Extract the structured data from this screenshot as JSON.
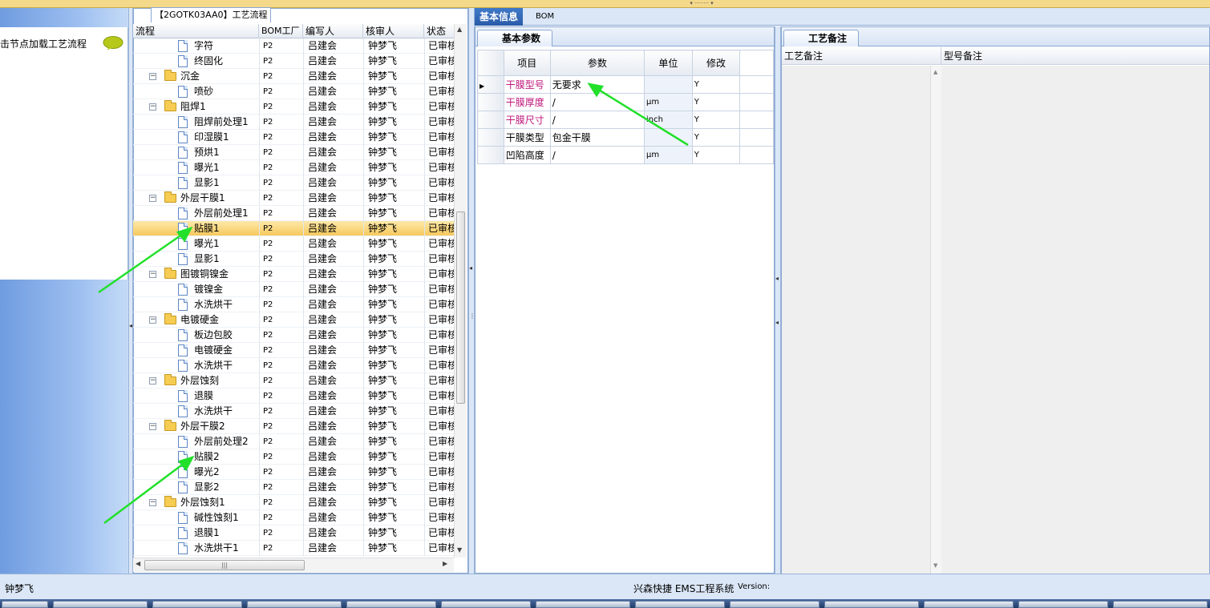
{
  "left_panel": {
    "hint": "击节点加载工艺流程",
    "chat_icon": "speech-bubble-icon"
  },
  "tree": {
    "title": "【2GOTK03AA0】工艺流程",
    "columns": {
      "flow": "流程",
      "bom": "BOM工厂",
      "author": "编写人",
      "reviewer": "核审人",
      "status": "状态"
    },
    "rows": [
      {
        "label": "字符",
        "type": "doc",
        "level": 2,
        "bom": "P2",
        "author": "吕建会",
        "reviewer": "钟梦飞",
        "status": "已审核",
        "selected": false
      },
      {
        "label": "终固化",
        "type": "doc",
        "level": 2,
        "bom": "P2",
        "author": "吕建会",
        "reviewer": "钟梦飞",
        "status": "已审核",
        "selected": false
      },
      {
        "label": "沉金",
        "type": "folder",
        "level": 1,
        "bom": "P2",
        "author": "吕建会",
        "reviewer": "钟梦飞",
        "status": "已审核",
        "selected": false
      },
      {
        "label": "喷砂",
        "type": "doc",
        "level": 2,
        "bom": "P2",
        "author": "吕建会",
        "reviewer": "钟梦飞",
        "status": "已审核",
        "selected": false
      },
      {
        "label": "阻焊1",
        "type": "folder",
        "level": 1,
        "bom": "P2",
        "author": "吕建会",
        "reviewer": "钟梦飞",
        "status": "已审核",
        "selected": false
      },
      {
        "label": "阻焊前处理1",
        "type": "doc",
        "level": 2,
        "bom": "P2",
        "author": "吕建会",
        "reviewer": "钟梦飞",
        "status": "已审核",
        "selected": false
      },
      {
        "label": "印湿膜1",
        "type": "doc",
        "level": 2,
        "bom": "P2",
        "author": "吕建会",
        "reviewer": "钟梦飞",
        "status": "已审核",
        "selected": false
      },
      {
        "label": "预烘1",
        "type": "doc",
        "level": 2,
        "bom": "P2",
        "author": "吕建会",
        "reviewer": "钟梦飞",
        "status": "已审核",
        "selected": false
      },
      {
        "label": "曝光1",
        "type": "doc",
        "level": 2,
        "bom": "P2",
        "author": "吕建会",
        "reviewer": "钟梦飞",
        "status": "已审核",
        "selected": false
      },
      {
        "label": "显影1",
        "type": "doc",
        "level": 2,
        "bom": "P2",
        "author": "吕建会",
        "reviewer": "钟梦飞",
        "status": "已审核",
        "selected": false
      },
      {
        "label": "外层干膜1",
        "type": "folder",
        "level": 1,
        "bom": "P2",
        "author": "吕建会",
        "reviewer": "钟梦飞",
        "status": "已审核",
        "selected": false
      },
      {
        "label": "外层前处理1",
        "type": "doc",
        "level": 2,
        "bom": "P2",
        "author": "吕建会",
        "reviewer": "钟梦飞",
        "status": "已审核",
        "selected": false
      },
      {
        "label": "贴膜1",
        "type": "doc",
        "level": 2,
        "bom": "P2",
        "author": "吕建会",
        "reviewer": "钟梦飞",
        "status": "已审核",
        "selected": true
      },
      {
        "label": "曝光1",
        "type": "doc",
        "level": 2,
        "bom": "P2",
        "author": "吕建会",
        "reviewer": "钟梦飞",
        "status": "已审核",
        "selected": false
      },
      {
        "label": "显影1",
        "type": "doc",
        "level": 2,
        "bom": "P2",
        "author": "吕建会",
        "reviewer": "钟梦飞",
        "status": "已审核",
        "selected": false
      },
      {
        "label": "图镀铜镍金",
        "type": "folder",
        "level": 1,
        "bom": "P2",
        "author": "吕建会",
        "reviewer": "钟梦飞",
        "status": "已审核",
        "selected": false
      },
      {
        "label": "镀镍金",
        "type": "doc",
        "level": 2,
        "bom": "P2",
        "author": "吕建会",
        "reviewer": "钟梦飞",
        "status": "已审核",
        "selected": false
      },
      {
        "label": "水洗烘干",
        "type": "doc",
        "level": 2,
        "bom": "P2",
        "author": "吕建会",
        "reviewer": "钟梦飞",
        "status": "已审核",
        "selected": false
      },
      {
        "label": "电镀硬金",
        "type": "folder",
        "level": 1,
        "bom": "P2",
        "author": "吕建会",
        "reviewer": "钟梦飞",
        "status": "已审核",
        "selected": false
      },
      {
        "label": "板边包胶",
        "type": "doc",
        "level": 2,
        "bom": "P2",
        "author": "吕建会",
        "reviewer": "钟梦飞",
        "status": "已审核",
        "selected": false
      },
      {
        "label": "电镀硬金",
        "type": "doc",
        "level": 2,
        "bom": "P2",
        "author": "吕建会",
        "reviewer": "钟梦飞",
        "status": "已审核",
        "selected": false
      },
      {
        "label": "水洗烘干",
        "type": "doc",
        "level": 2,
        "bom": "P2",
        "author": "吕建会",
        "reviewer": "钟梦飞",
        "status": "已审核",
        "selected": false
      },
      {
        "label": "外层蚀刻",
        "type": "folder",
        "level": 1,
        "bom": "P2",
        "author": "吕建会",
        "reviewer": "钟梦飞",
        "status": "已审核",
        "selected": false
      },
      {
        "label": "退膜",
        "type": "doc",
        "level": 2,
        "bom": "P2",
        "author": "吕建会",
        "reviewer": "钟梦飞",
        "status": "已审核",
        "selected": false
      },
      {
        "label": "水洗烘干",
        "type": "doc",
        "level": 2,
        "bom": "P2",
        "author": "吕建会",
        "reviewer": "钟梦飞",
        "status": "已审核",
        "selected": false
      },
      {
        "label": "外层干膜2",
        "type": "folder",
        "level": 1,
        "bom": "P2",
        "author": "吕建会",
        "reviewer": "钟梦飞",
        "status": "已审核",
        "selected": false
      },
      {
        "label": "外层前处理2",
        "type": "doc",
        "level": 2,
        "bom": "P2",
        "author": "吕建会",
        "reviewer": "钟梦飞",
        "status": "已审核",
        "selected": false
      },
      {
        "label": "贴膜2",
        "type": "doc",
        "level": 2,
        "bom": "P2",
        "author": "吕建会",
        "reviewer": "钟梦飞",
        "status": "已审核",
        "selected": false
      },
      {
        "label": "曝光2",
        "type": "doc",
        "level": 2,
        "bom": "P2",
        "author": "吕建会",
        "reviewer": "钟梦飞",
        "status": "已审核",
        "selected": false
      },
      {
        "label": "显影2",
        "type": "doc",
        "level": 2,
        "bom": "P2",
        "author": "吕建会",
        "reviewer": "钟梦飞",
        "status": "已审核",
        "selected": false
      },
      {
        "label": "外层蚀刻1",
        "type": "folder",
        "level": 1,
        "bom": "P2",
        "author": "吕建会",
        "reviewer": "钟梦飞",
        "status": "已审核",
        "selected": false
      },
      {
        "label": "碱性蚀刻1",
        "type": "doc",
        "level": 2,
        "bom": "P2",
        "author": "吕建会",
        "reviewer": "钟梦飞",
        "status": "已审核",
        "selected": false
      },
      {
        "label": "退膜1",
        "type": "doc",
        "level": 2,
        "bom": "P2",
        "author": "吕建会",
        "reviewer": "钟梦飞",
        "status": "已审核",
        "selected": false
      },
      {
        "label": "水洗烘干1",
        "type": "doc",
        "level": 2,
        "bom": "P2",
        "author": "吕建会",
        "reviewer": "钟梦飞",
        "status": "已审核",
        "selected": false
      }
    ]
  },
  "main_tabs": [
    {
      "label": "基本信息",
      "active": true
    },
    {
      "label": "BOM",
      "active": false
    }
  ],
  "params": {
    "tab_label": "基本参数",
    "headers": {
      "item": "项目",
      "param": "参数",
      "unit": "单位",
      "modify": "修改"
    },
    "rows": [
      {
        "item": "干膜型号",
        "param": "无要求",
        "unit": "",
        "modify": "Y",
        "pink": true,
        "current": true
      },
      {
        "item": "干膜厚度",
        "param": "/",
        "unit": "μm",
        "modify": "Y",
        "pink": true,
        "current": false
      },
      {
        "item": "干膜尺寸",
        "param": "/",
        "unit": "inch",
        "modify": "Y",
        "pink": true,
        "current": false
      },
      {
        "item": "干膜类型",
        "param": "包金干膜",
        "unit": "",
        "modify": "Y",
        "pink": false,
        "current": false
      },
      {
        "item": "凹陷高度",
        "param": "/",
        "unit": "μm",
        "modify": "Y",
        "pink": false,
        "current": false
      }
    ]
  },
  "notes": {
    "tab_label": "工艺备注",
    "process_note": "工艺备注",
    "model_note": "型号备注"
  },
  "status_bar": {
    "user": "钟梦飞",
    "system": "兴森快捷 EMS工程系统",
    "version": "Version:"
  },
  "colors": {
    "accent": "#2a5ca8",
    "selected_row": "#f7c95d",
    "pink_text": "#c0177c",
    "annotation_arrow": "#22e02a"
  }
}
